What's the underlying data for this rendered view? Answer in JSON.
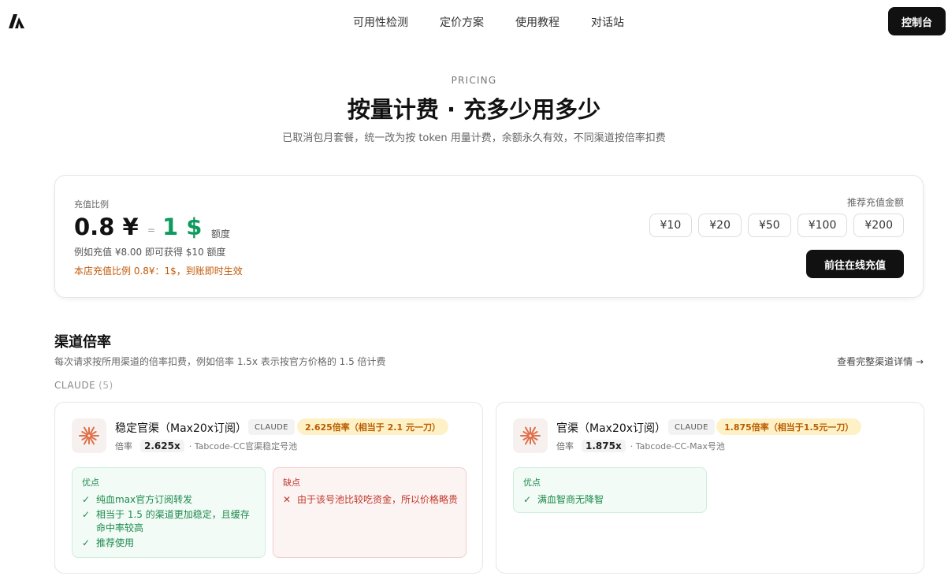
{
  "header": {
    "logo_icon": "brand-logo-icon",
    "nav": [
      "可用性检测",
      "定价方案",
      "使用教程",
      "对话站"
    ],
    "console_button": "控制台"
  },
  "hero": {
    "eyebrow": "PRICING",
    "title": "按量计费 · 充多少用多少",
    "subtitle": "已取消包月套餐，统一改为按 token 用量计费，余额永久有效，不同渠道按倍率扣费"
  },
  "rate_card": {
    "label": "充值比例",
    "cny": "0.8 ¥",
    "equals": "=",
    "usd": "1 $",
    "unit": "额度",
    "example": "例如充值 ¥8.00 即可获得 $10 额度",
    "note": "本店充值比例 0.8¥：1$，到账即时生效",
    "recommend_label": "推荐充值金额",
    "amounts": [
      "¥10",
      "¥20",
      "¥50",
      "¥100",
      "¥200"
    ],
    "recharge_button": "前往在线充值"
  },
  "channels": {
    "title": "渠道倍率",
    "description": "每次请求按所用渠道的倍率扣费，例如倍率 1.5x 表示按官方价格的 1.5 倍计费",
    "details_link": "查看完整渠道详情 →",
    "group_label": "CLAUDE",
    "group_count": "(5)",
    "icon": "claude-sunburst-icon",
    "accent_color": "#e0704a",
    "cards": [
      {
        "name": "稳定官渠（Max20x订阅）",
        "tag": "CLAUDE",
        "badge": "2.625倍率（相当于 2.1 元一刀）",
        "rate_label": "倍率",
        "multiplier": "2.625x",
        "source": "· Tabcode-CC官渠稳定号池",
        "pros_title": "优点",
        "pros": [
          "纯血max官方订阅转发",
          "相当于 1.5 的渠道更加稳定，且缓存命中率较高",
          "推荐使用"
        ],
        "cons_title": "缺点",
        "cons": [
          "由于该号池比较吃资金，所以价格略贵"
        ]
      },
      {
        "name": "官渠（Max20x订阅）",
        "tag": "CLAUDE",
        "badge": "1.875倍率（相当于1.5元一刀）",
        "rate_label": "倍率",
        "multiplier": "1.875x",
        "source": "· Tabcode-CC-Max号池",
        "pros_title": "优点",
        "pros": [
          "满血智商无降智"
        ]
      }
    ]
  }
}
